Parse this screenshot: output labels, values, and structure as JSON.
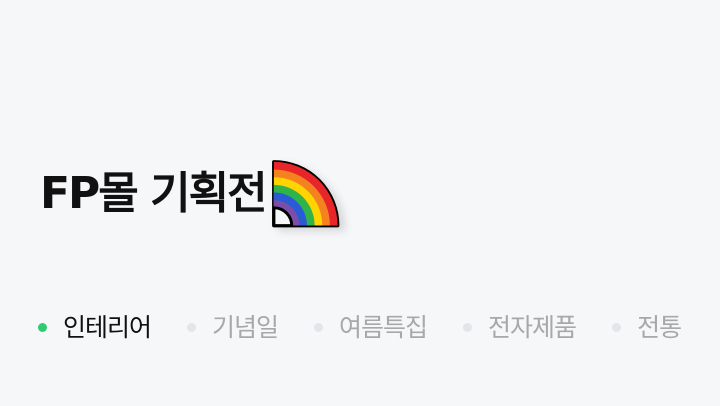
{
  "header": {
    "title": "FP몰 기획전",
    "title_icon": "rainbow-icon"
  },
  "tabs": [
    {
      "label": "인테리어",
      "active": true
    },
    {
      "label": "기념일",
      "active": false
    },
    {
      "label": "여름특집",
      "active": false
    },
    {
      "label": "전자제품",
      "active": false
    },
    {
      "label": "전통",
      "active": false
    }
  ],
  "colors": {
    "background": "#f6f7f9",
    "title": "#111111",
    "tab_active_text": "#111111",
    "tab_inactive_text": "#a8a8a8",
    "tab_active_dot": "#2ecc71",
    "tab_inactive_dot": "#e3e5e8",
    "rainbow": [
      "#e8262a",
      "#f58220",
      "#ffd400",
      "#2fb34a",
      "#2a5bd7",
      "#7b4fa8"
    ]
  }
}
